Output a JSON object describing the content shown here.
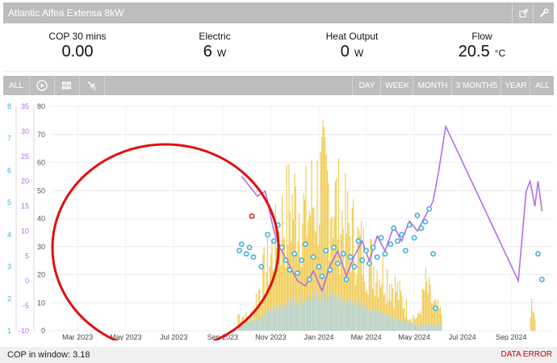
{
  "window": {
    "title": "Atlantic Alfea Extensa 8kW"
  },
  "stats": [
    {
      "label": "COP 30 mins",
      "value": "0.00",
      "unit": ""
    },
    {
      "label": "Electric",
      "value": "6",
      "unit": "W"
    },
    {
      "label": "Heat Output",
      "value": "0",
      "unit": "W"
    },
    {
      "label": "Flow",
      "value": "20.5",
      "unit": "°C"
    }
  ],
  "toolbar": {
    "all_label": "ALL",
    "ranges": [
      "DAY",
      "WEEK",
      "MONTH",
      "3 MONTHS",
      "YEAR",
      "ALL"
    ]
  },
  "footer": {
    "cop_label": "COP in window:",
    "cop_value": "3.18",
    "error": "DATA ERROR"
  },
  "colors": {
    "heat": "#f0c94c",
    "electric": "#b5d4d6",
    "flow": "#b36ee6",
    "cop": "#3fb3d6",
    "annotation": "#e01010"
  },
  "chart_data": {
    "type": "bar",
    "x_ticks": [
      "Mar 2023",
      "May 2023",
      "Jul 2023",
      "Sep 2023",
      "Nov 2023",
      "Jan 2024",
      "Mar 2024",
      "May 2024",
      "Jul 2024",
      "Sep 2024"
    ],
    "y_left_ticks": [
      "0",
      "10",
      "20",
      "30",
      "40",
      "50",
      "60",
      "70",
      "80"
    ],
    "y_cop_ticks": [
      "1",
      "2",
      "3",
      "4",
      "5",
      "6",
      "7",
      "8"
    ],
    "y_temp_ticks": [
      "-10",
      "-5",
      "0",
      "5",
      "10",
      "15",
      "20",
      "25",
      "30",
      "35"
    ],
    "ylim_left": [
      0,
      80
    ],
    "ylim_temp": [
      -10,
      35
    ],
    "ylim_cop": [
      1,
      8
    ],
    "grid": true,
    "series": [
      {
        "name": "heat",
        "points": [
          [
            "2023-09-20",
            8
          ],
          [
            "2023-10-05",
            6
          ],
          [
            "2023-10-15",
            18
          ],
          [
            "2023-10-25",
            30
          ],
          [
            "2023-11-05",
            40
          ],
          [
            "2023-11-15",
            52
          ],
          [
            "2023-11-25",
            60
          ],
          [
            "2023-12-05",
            62
          ],
          [
            "2023-12-15",
            55
          ],
          [
            "2023-12-25",
            65
          ],
          [
            "2024-01-05",
            70
          ],
          [
            "2024-01-15",
            68
          ],
          [
            "2024-01-25",
            58
          ],
          [
            "2024-02-05",
            50
          ],
          [
            "2024-02-15",
            45
          ],
          [
            "2024-02-25",
            38
          ],
          [
            "2024-03-05",
            34
          ],
          [
            "2024-03-15",
            30
          ],
          [
            "2024-03-25",
            28
          ],
          [
            "2024-04-05",
            22
          ],
          [
            "2024-04-15",
            15
          ],
          [
            "2024-04-25",
            8
          ],
          [
            "2024-05-05",
            6
          ],
          [
            "2024-05-15",
            22
          ],
          [
            "2024-05-25",
            12
          ],
          [
            "2024-06-05",
            8
          ],
          [
            "2024-09-25",
            12
          ],
          [
            "2024-10-01",
            6
          ]
        ]
      },
      {
        "name": "electric",
        "points": [
          [
            "2023-09-20",
            2
          ],
          [
            "2023-10-15",
            5
          ],
          [
            "2023-11-05",
            9
          ],
          [
            "2023-11-25",
            12
          ],
          [
            "2023-12-15",
            13
          ],
          [
            "2024-01-05",
            14
          ],
          [
            "2024-01-25",
            13
          ],
          [
            "2024-02-15",
            11
          ],
          [
            "2024-03-05",
            9
          ],
          [
            "2024-03-25",
            7
          ],
          [
            "2024-04-15",
            4
          ],
          [
            "2024-05-05",
            2
          ],
          [
            "2024-05-25",
            3
          ],
          [
            "2024-06-05",
            2
          ]
        ]
      },
      {
        "name": "flow",
        "points": [
          [
            "2023-09-25",
            21
          ],
          [
            "2023-10-05",
            19
          ],
          [
            "2023-10-15",
            17
          ],
          [
            "2023-10-25",
            18
          ],
          [
            "2023-11-05",
            10
          ],
          [
            "2023-11-15",
            6
          ],
          [
            "2023-11-25",
            3
          ],
          [
            "2023-12-05",
            0
          ],
          [
            "2023-12-15",
            -1
          ],
          [
            "2023-12-25",
            2
          ],
          [
            "2024-01-05",
            -2
          ],
          [
            "2024-01-15",
            3
          ],
          [
            "2024-01-25",
            6
          ],
          [
            "2024-02-05",
            1
          ],
          [
            "2024-02-15",
            5
          ],
          [
            "2024-02-25",
            8
          ],
          [
            "2024-03-05",
            4
          ],
          [
            "2024-03-15",
            9
          ],
          [
            "2024-03-25",
            6
          ],
          [
            "2024-04-05",
            11
          ],
          [
            "2024-04-15",
            8
          ],
          [
            "2024-04-25",
            12
          ],
          [
            "2024-05-05",
            10
          ],
          [
            "2024-05-15",
            13
          ],
          [
            "2024-05-25",
            16
          ],
          [
            "2024-06-01",
            22
          ],
          [
            "2024-06-10",
            31
          ],
          [
            "2024-09-10",
            0
          ],
          [
            "2024-09-20",
            18
          ],
          [
            "2024-09-25",
            20
          ],
          [
            "2024-10-01",
            15
          ],
          [
            "2024-10-05",
            20
          ],
          [
            "2024-10-10",
            14
          ]
        ]
      },
      {
        "name": "cop",
        "points": [
          [
            "2023-09-22",
            3.5
          ],
          [
            "2023-09-25",
            3.7
          ],
          [
            "2023-10-01",
            3.4
          ],
          [
            "2023-10-05",
            3.6
          ],
          [
            "2023-10-10",
            3.3
          ],
          [
            "2023-10-20",
            3.0
          ],
          [
            "2023-10-28",
            4.0
          ],
          [
            "2023-11-05",
            3.8
          ],
          [
            "2023-11-10",
            4.3
          ],
          [
            "2023-11-15",
            3.6
          ],
          [
            "2023-11-20",
            3.2
          ],
          [
            "2023-11-25",
            2.9
          ],
          [
            "2023-12-01",
            3.4
          ],
          [
            "2023-12-05",
            2.8
          ],
          [
            "2023-12-10",
            3.2
          ],
          [
            "2023-12-15",
            3.7
          ],
          [
            "2023-12-20",
            2.6
          ],
          [
            "2023-12-25",
            3.3
          ],
          [
            "2024-01-01",
            3.0
          ],
          [
            "2024-01-05",
            2.7
          ],
          [
            "2024-01-10",
            3.5
          ],
          [
            "2024-01-15",
            2.9
          ],
          [
            "2024-01-20",
            3.6
          ],
          [
            "2024-01-25",
            3.1
          ],
          [
            "2024-02-01",
            3.4
          ],
          [
            "2024-02-05",
            2.6
          ],
          [
            "2024-02-10",
            3.3
          ],
          [
            "2024-02-15",
            3.0
          ],
          [
            "2024-02-20",
            3.8
          ],
          [
            "2024-02-25",
            3.2
          ],
          [
            "2024-03-01",
            3.5
          ],
          [
            "2024-03-05",
            3.1
          ],
          [
            "2024-03-10",
            3.6
          ],
          [
            "2024-03-15",
            3.3
          ],
          [
            "2024-03-20",
            3.9
          ],
          [
            "2024-03-25",
            3.4
          ],
          [
            "2024-04-01",
            3.7
          ],
          [
            "2024-04-05",
            4.2
          ],
          [
            "2024-04-10",
            3.8
          ],
          [
            "2024-04-15",
            4.0
          ],
          [
            "2024-04-20",
            3.5
          ],
          [
            "2024-04-25",
            4.3
          ],
          [
            "2024-05-01",
            3.9
          ],
          [
            "2024-05-05",
            4.6
          ],
          [
            "2024-05-10",
            4.2
          ],
          [
            "2024-05-15",
            4.4
          ],
          [
            "2024-05-20",
            4.8
          ],
          [
            "2024-05-25",
            3.4
          ],
          [
            "2024-05-28",
            1.7
          ],
          [
            "2024-10-05",
            3.4
          ],
          [
            "2024-10-10",
            2.6
          ]
        ]
      }
    ]
  }
}
